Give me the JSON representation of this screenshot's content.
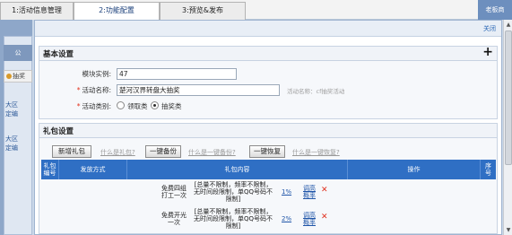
{
  "tabs": [
    {
      "label": "1:活动信息管理"
    },
    {
      "label": "2:功能配置"
    },
    {
      "label": "3:预览&发布"
    }
  ],
  "corner_button": "老板商",
  "close_link": "关闭",
  "left_nav": {
    "head": "公",
    "selected": "抽奖",
    "items": [
      "大区\n定编",
      "大区\n定编"
    ]
  },
  "basic": {
    "title": "基本设置",
    "module_label": "模块实例:",
    "module_value": "47",
    "name_label": "活动名称:",
    "name_value": "楚河汉界转盘大抽奖",
    "name_hint": "活动名称：cf抽奖活动",
    "type_label": "活动类别:",
    "type_options": [
      {
        "label": "领取类",
        "selected": false
      },
      {
        "label": "抽奖类",
        "selected": true
      }
    ]
  },
  "gift": {
    "title": "礼包设置",
    "buttons": {
      "add": "新增礼包",
      "backup": "一键备份",
      "restore": "一键恢复"
    },
    "links": {
      "what_gift": "什么是礼包?",
      "what_backup": "什么是一键备份?",
      "what_restore": "什么是一键恢复?"
    },
    "columns": [
      "礼包\n编号",
      "发放方式",
      "礼包内容",
      "操作",
      "序\n号"
    ],
    "rows": [
      {
        "name": "免费四组\n打工一次",
        "limit": "[总量不限制，频率不限制，\n无时间段限制，单QQ号码不\n限制]",
        "rate": "1%",
        "action": "调高\n概率"
      },
      {
        "name": "免费开光\n一次",
        "limit": "[总量不限制，频率不限制，\n无时间段限制，单QQ号码不\n限制]",
        "rate": "2%",
        "action": "调高\n概率"
      }
    ]
  }
}
